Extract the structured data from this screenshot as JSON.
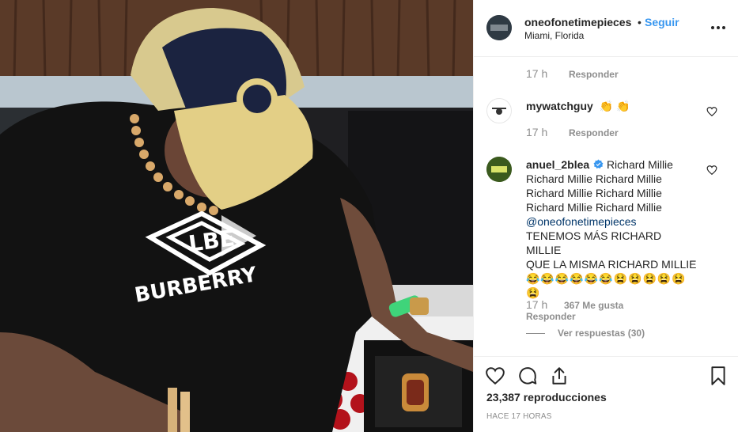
{
  "header": {
    "username": "oneofonetimepieces",
    "separator": "•",
    "follow_label": "Seguir",
    "location": "Miami, Florida",
    "avatar_text": "ONE OF ONE"
  },
  "comments": [
    {
      "time": "17 h",
      "reply_label": "Responder"
    },
    {
      "username": "mywatchguy",
      "text": "👏 👏",
      "time": "17 h",
      "reply_label": "Responder"
    },
    {
      "username": "anuel_2blea",
      "text_lines": [
        "Richard Millie",
        "Richard Millie Richard Millie",
        "Richard Millie Richard Millie",
        "Richard Millie Richard Millie"
      ],
      "mention": "@oneofonetimepieces",
      "caps_lines": [
        "TENEMOS MÁS RICHARD MILLIE",
        "QUE LA MISMA RICHARD MILLIE"
      ],
      "emoji_line1": "😂😂😂😂😂😂😫😫😫😫😫",
      "emoji_line2": "😫",
      "time": "17 h",
      "likes": "367 Me gusta",
      "reply_label": "Responder",
      "view_replies": "Ver respuestas (30)"
    }
  ],
  "footer": {
    "views_count": "23,387",
    "views_label": "reproducciones",
    "time_ago": "HACE 17 HORAS"
  },
  "video": {
    "shirt_text": "BURBERRY",
    "logo_text": "LBE"
  },
  "icons": {
    "heart": "heart-icon",
    "comment": "comment-icon",
    "share": "share-icon",
    "save": "bookmark-icon",
    "more": "more-icon",
    "play": "play-icon",
    "verified": "verified-badge-icon"
  },
  "colors": {
    "accent": "#3897f0",
    "text": "#262626",
    "muted": "#8e8e8e",
    "border": "#efefef"
  }
}
